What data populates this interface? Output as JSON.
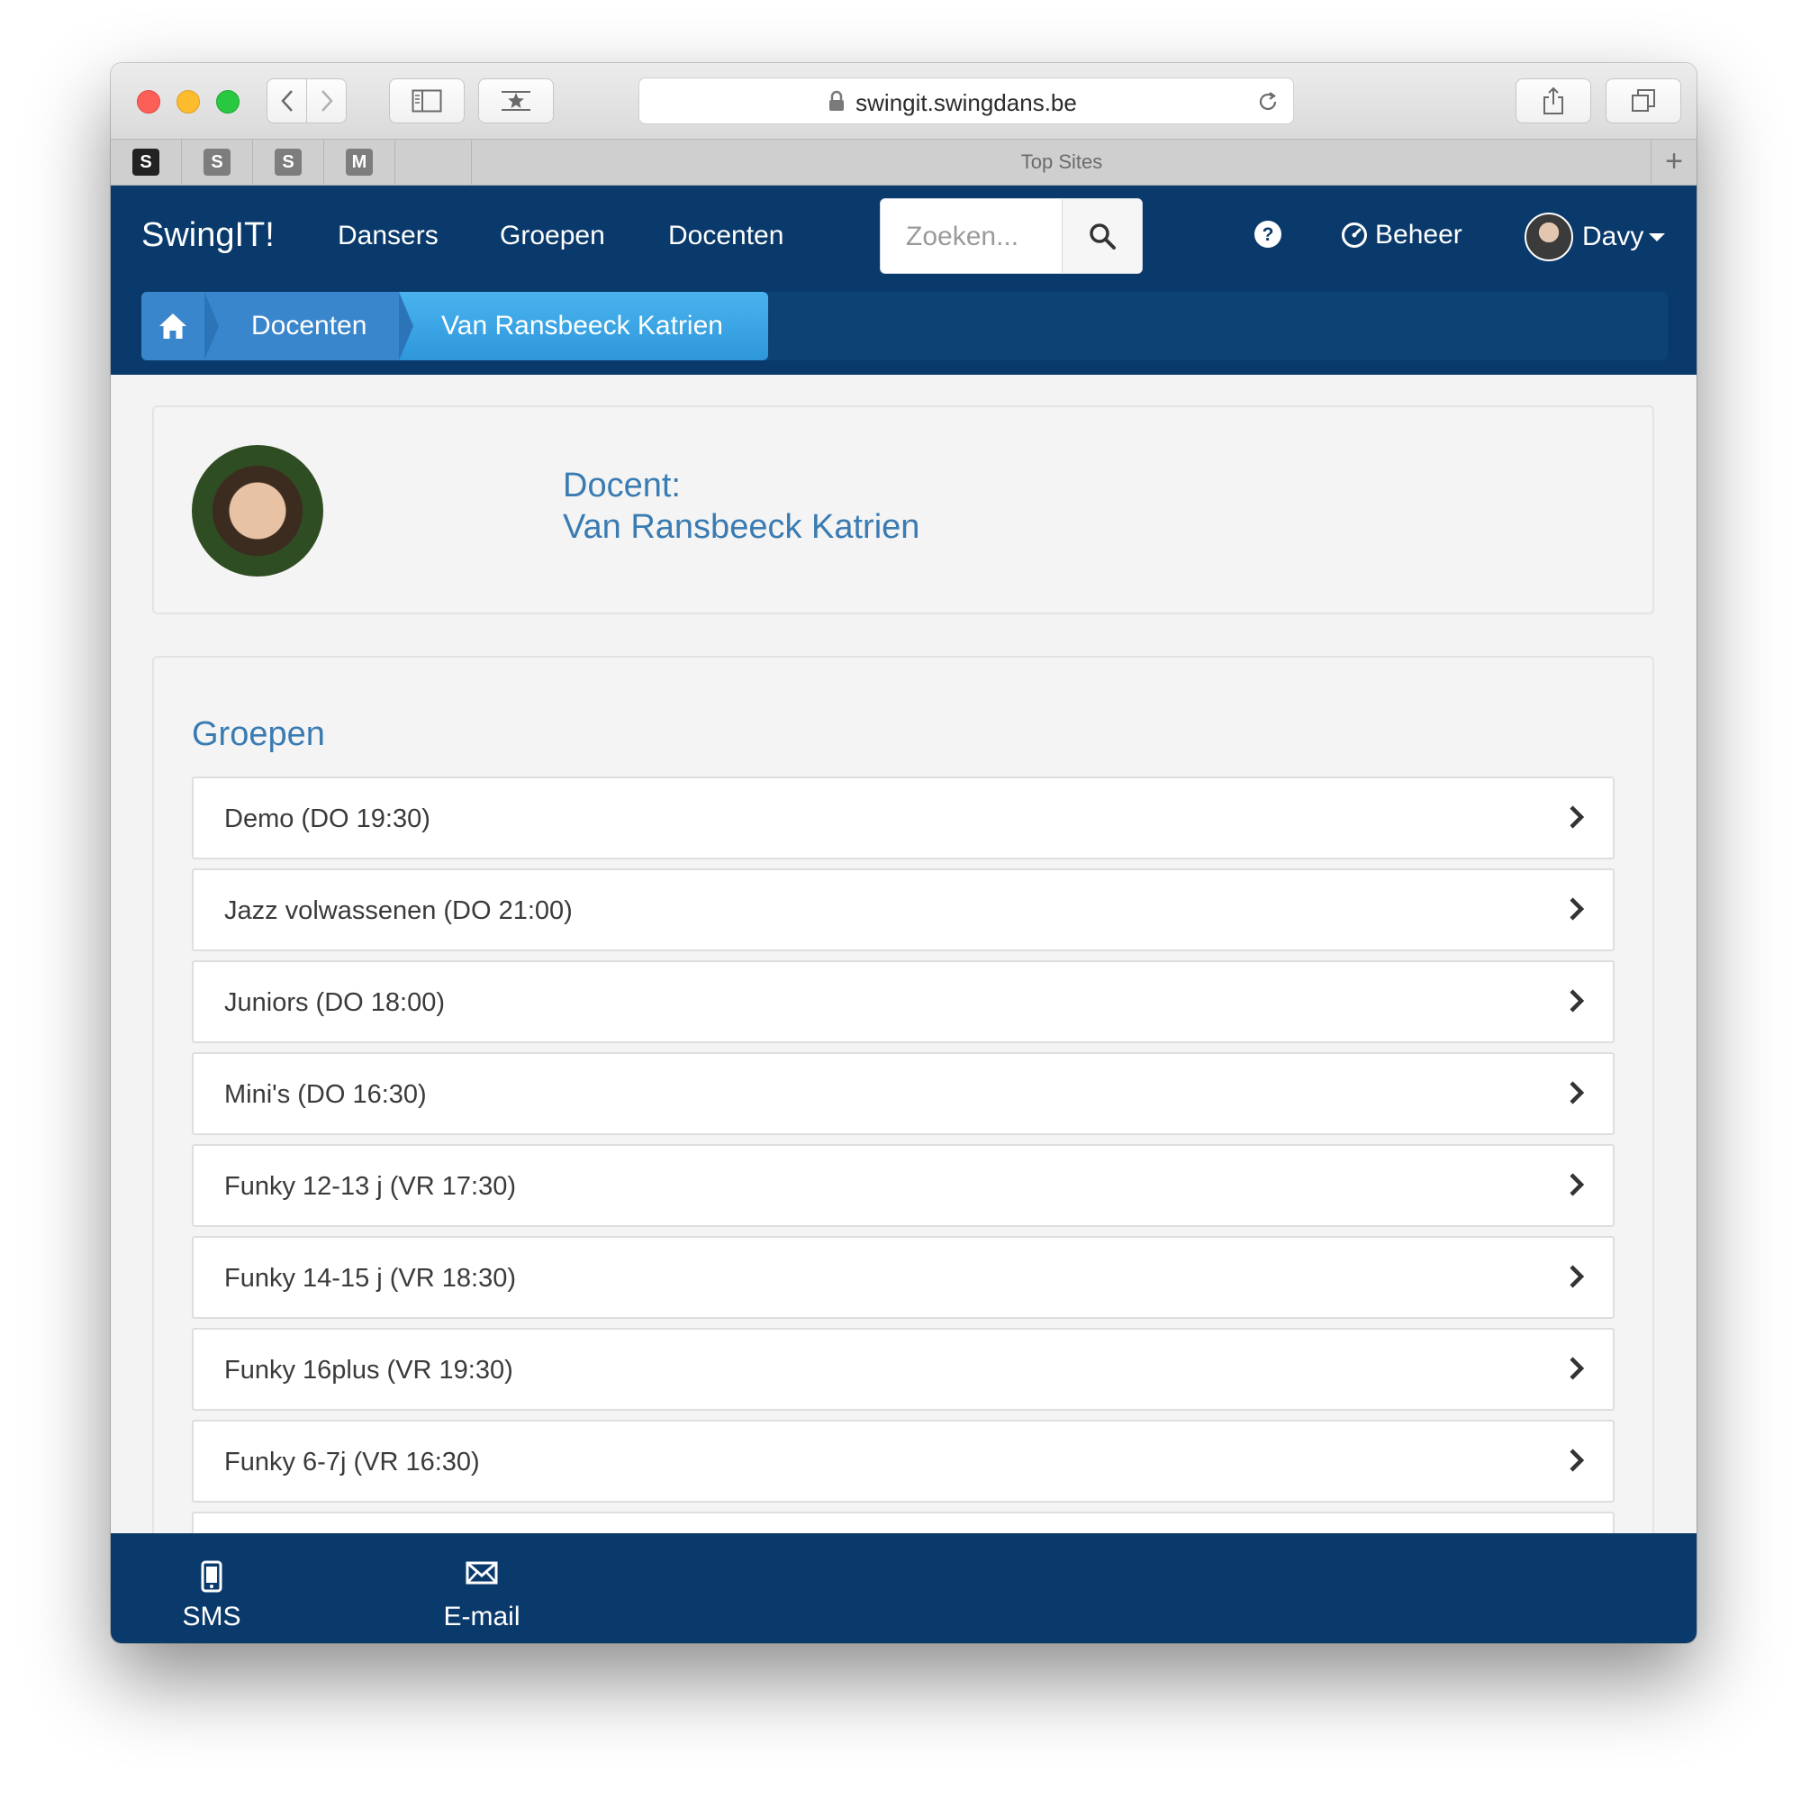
{
  "browser": {
    "url": "swingit.swingdans.be",
    "favorites": [
      "S",
      "S",
      "S",
      "M"
    ],
    "top_sites_label": "Top Sites",
    "new_tab_label": "+"
  },
  "navbar": {
    "brand": "SwingIT!",
    "links": [
      "Dansers",
      "Groepen",
      "Docenten"
    ],
    "search_placeholder": "Zoeken...",
    "beheer": "Beheer",
    "user": "Davy"
  },
  "breadcrumb": {
    "items": [
      "Docenten",
      "Van Ransbeeck Katrien"
    ]
  },
  "profile": {
    "label": "Docent:",
    "name": "Van Ransbeeck Katrien"
  },
  "groups": {
    "title": "Groepen",
    "items": [
      "Demo (DO 19:30)",
      "Jazz volwassenen (DO 21:00)",
      "Juniors (DO 18:00)",
      "Mini's (DO 16:30)",
      "Funky 12-13 j (VR 17:30)",
      "Funky 14-15 j (VR 18:30)",
      "Funky 16plus (VR 19:30)",
      "Funky 6-7j (VR 16:30)",
      ""
    ]
  },
  "footer": {
    "sms": "SMS",
    "email": "E-mail"
  },
  "colors": {
    "navbar": "#0a3a6b",
    "accent": "#3a7bb2",
    "breadcrumb_active": "#2e97db"
  }
}
